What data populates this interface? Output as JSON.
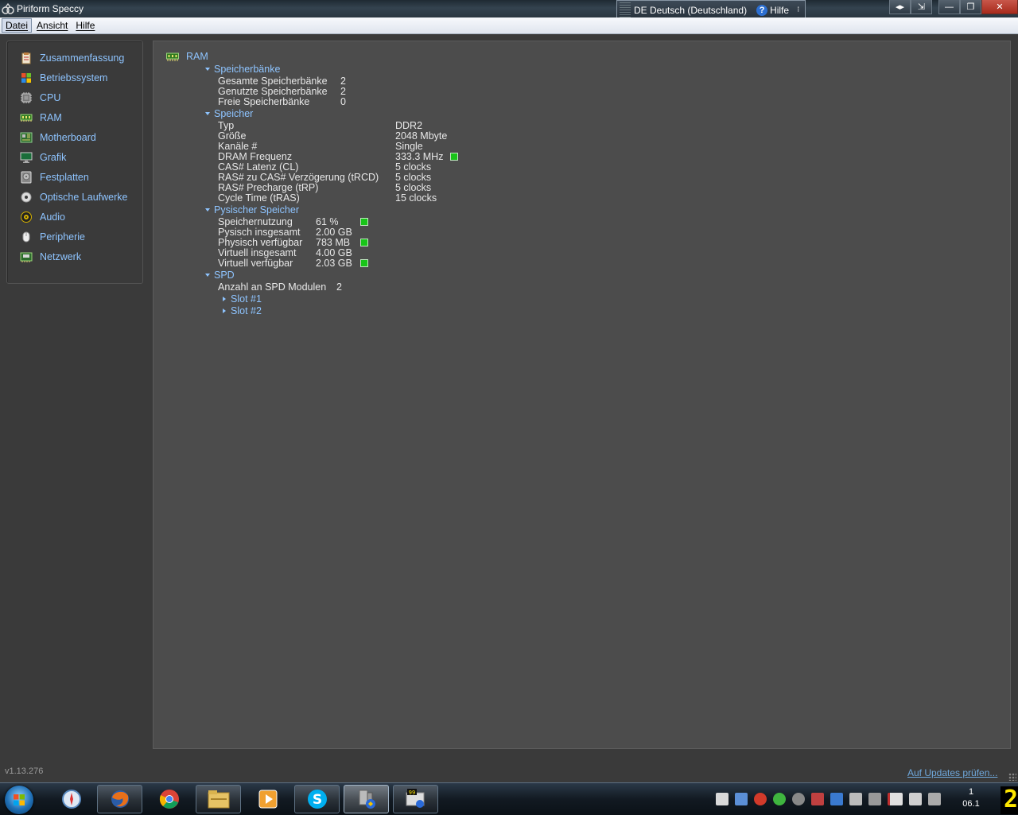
{
  "window": {
    "title": "Piriform Speccy",
    "language_bar": {
      "lang": "DE Deutsch (Deutschland)",
      "help": "Hilfe"
    }
  },
  "menu": [
    "Datei",
    "Ansicht",
    "Hilfe"
  ],
  "sidebar": {
    "items": [
      {
        "label": "Zusammenfassung",
        "icon": "summary-icon"
      },
      {
        "label": "Betriebssystem",
        "icon": "windows-icon"
      },
      {
        "label": "CPU",
        "icon": "cpu-icon"
      },
      {
        "label": "RAM",
        "icon": "ram-icon"
      },
      {
        "label": "Motherboard",
        "icon": "motherboard-icon"
      },
      {
        "label": "Grafik",
        "icon": "monitor-icon"
      },
      {
        "label": "Festplatten",
        "icon": "harddisk-icon"
      },
      {
        "label": "Optische Laufwerke",
        "icon": "optical-drive-icon"
      },
      {
        "label": "Audio",
        "icon": "speaker-icon"
      },
      {
        "label": "Peripherie",
        "icon": "mouse-icon"
      },
      {
        "label": "Netzwerk",
        "icon": "network-icon"
      }
    ]
  },
  "main": {
    "title": "RAM",
    "speicherbanke": {
      "header": "Speicherbänke",
      "rows": [
        {
          "label": "Gesamte Speicherbänke",
          "value": "2"
        },
        {
          "label": "Genutzte Speicherbänke",
          "value": "2"
        },
        {
          "label": "Freie Speicherbänke",
          "value": "0"
        }
      ]
    },
    "speicher": {
      "header": "Speicher",
      "rows": [
        {
          "label": "Typ",
          "value": "DDR2"
        },
        {
          "label": "Größe",
          "value": "2048 Mbyte"
        },
        {
          "label": "Kanäle #",
          "value": "Single"
        },
        {
          "label": "DRAM Frequenz",
          "value": "333.3 MHz"
        },
        {
          "label": "CAS# Latenz (CL)",
          "value": "5 clocks"
        },
        {
          "label": "RAS# zu CAS# Verzögerung (tRCD)",
          "value": "5 clocks"
        },
        {
          "label": "RAS# Precharge (tRP)",
          "value": "5 clocks"
        },
        {
          "label": "Cycle Time (tRAS)",
          "value": "15 clocks"
        }
      ]
    },
    "physisch": {
      "header": "Pysischer Speicher",
      "rows": [
        {
          "label": "Speichernutzung",
          "value": "61 %"
        },
        {
          "label": "Pysisch insgesamt",
          "value": "2.00 GB"
        },
        {
          "label": "Physisch verfügbar",
          "value": "783 MB"
        },
        {
          "label": "Virtuell insgesamt",
          "value": "4.00 GB"
        },
        {
          "label": "Virtuell verfügbar",
          "value": "2.03 GB"
        }
      ]
    },
    "spd": {
      "header": "SPD",
      "count_label": "Anzahl an SPD Modulen",
      "count_value": "2",
      "slots": [
        "Slot #1",
        "Slot #2"
      ]
    }
  },
  "footer": {
    "version": "v1.13.276",
    "update_link": "Auf Updates prüfen..."
  },
  "taskbar": {
    "clock_time": "1",
    "clock_date": "06.1",
    "corner_digit": "2"
  },
  "colors": {
    "accent_text": "#8ec4ff",
    "indicator_green": "#18c418",
    "panel_bg": "#4c4c4c",
    "window_bg": "#3a3a3a"
  }
}
